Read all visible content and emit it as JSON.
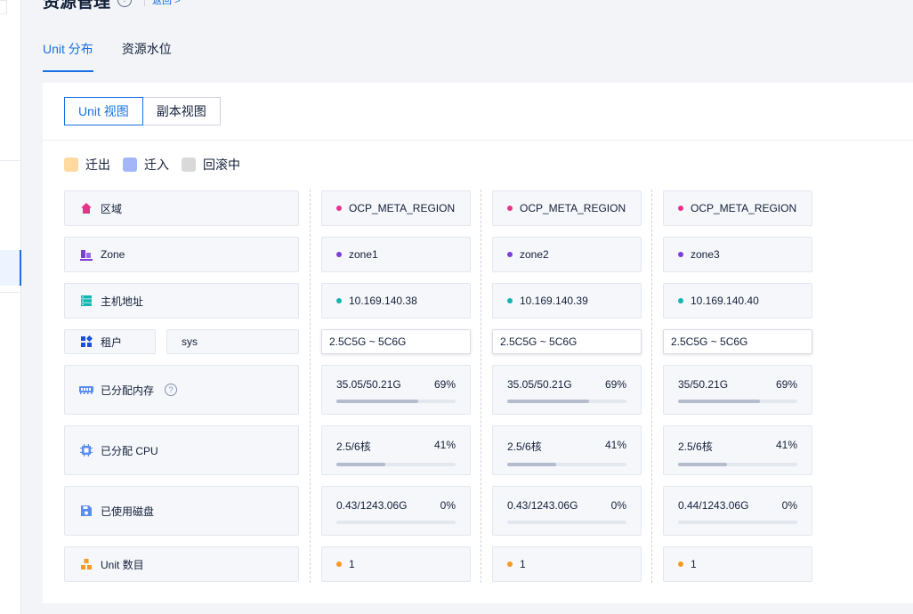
{
  "header": {
    "title": "资源管理",
    "help_icon": "?",
    "link_text": "返回 >"
  },
  "tabs": [
    {
      "label": "Unit 分布",
      "active": true
    },
    {
      "label": "资源水位",
      "active": false
    }
  ],
  "view_toggle": [
    {
      "label": "Unit 视图",
      "active": true
    },
    {
      "label": "副本视图",
      "active": false
    }
  ],
  "legend": [
    {
      "label": "迁出",
      "color": "#ffd9a0"
    },
    {
      "label": "迁入",
      "color": "#a3b6f7"
    },
    {
      "label": "回滚中",
      "color": "#d9d9d9"
    }
  ],
  "row_labels": {
    "region": "区域",
    "zone": "Zone",
    "host": "主机地址",
    "tenant": "租户",
    "tenant_value": "sys",
    "memory": "已分配内存",
    "cpu": "已分配 CPU",
    "disk": "已使用磁盘",
    "unit_count": "Unit 数目"
  },
  "icons": {
    "region": "home-icon",
    "zone": "zone-icon",
    "host": "server-icon",
    "tenant": "apps-icon",
    "memory": "memory-icon",
    "cpu": "cpu-icon",
    "disk": "disk-icon",
    "unit_count": "cluster-icon"
  },
  "colors": {
    "accent": "#1770e6",
    "region_dot": "#e6348b",
    "zone_dot": "#7a3fd6",
    "host_dot": "#13b5b1",
    "unit_dot": "#f59a23"
  },
  "columns": [
    {
      "region": "OCP_META_REGION",
      "zone": "zone1",
      "host": "10.169.140.38",
      "spec": "2.5C5G ~ 5C6G",
      "memory": {
        "text": "35.05/50.21G",
        "percent_label": "69%",
        "percent": 69
      },
      "cpu": {
        "text": "2.5/6核",
        "percent_label": "41%",
        "percent": 41
      },
      "disk": {
        "text": "0.43/1243.06G",
        "percent_label": "0%",
        "percent": 0
      },
      "units": "1"
    },
    {
      "region": "OCP_META_REGION",
      "zone": "zone2",
      "host": "10.169.140.39",
      "spec": "2.5C5G ~ 5C6G",
      "memory": {
        "text": "35.05/50.21G",
        "percent_label": "69%",
        "percent": 69
      },
      "cpu": {
        "text": "2.5/6核",
        "percent_label": "41%",
        "percent": 41
      },
      "disk": {
        "text": "0.43/1243.06G",
        "percent_label": "0%",
        "percent": 0
      },
      "units": "1"
    },
    {
      "region": "OCP_META_REGION",
      "zone": "zone3",
      "host": "10.169.140.40",
      "spec": "2.5C5G ~ 5C6G",
      "memory": {
        "text": "35/50.21G",
        "percent_label": "69%",
        "percent": 69
      },
      "cpu": {
        "text": "2.5/6核",
        "percent_label": "41%",
        "percent": 41
      },
      "disk": {
        "text": "0.44/1243.06G",
        "percent_label": "0%",
        "percent": 0
      },
      "units": "1"
    }
  ]
}
